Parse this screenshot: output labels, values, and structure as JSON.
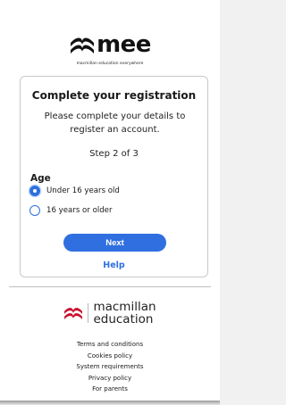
{
  "logo": {
    "wordmark": "mee",
    "tagline": "macmillan education everywhere",
    "icon": "macmillan-waves-icon"
  },
  "card": {
    "title": "Complete your registration",
    "description": "Please complete your details to register an account.",
    "step": "Step 2 of 3",
    "age_label": "Age",
    "options": [
      {
        "label": "Under 16 years old",
        "checked": true
      },
      {
        "label": "16 years or older",
        "checked": false
      }
    ],
    "next_label": "Next",
    "help_label": "Help"
  },
  "footer": {
    "brand_line1": "macmillan",
    "brand_line2": "education",
    "links": [
      "Terms and conditions",
      "Cookies policy",
      "System requirements",
      "Privacy policy",
      "For parents"
    ]
  },
  "colors": {
    "accent": "#2f6fe0",
    "brand_red": "#c8102e",
    "text": "#1a1a1a",
    "border": "#c9c9c9"
  }
}
